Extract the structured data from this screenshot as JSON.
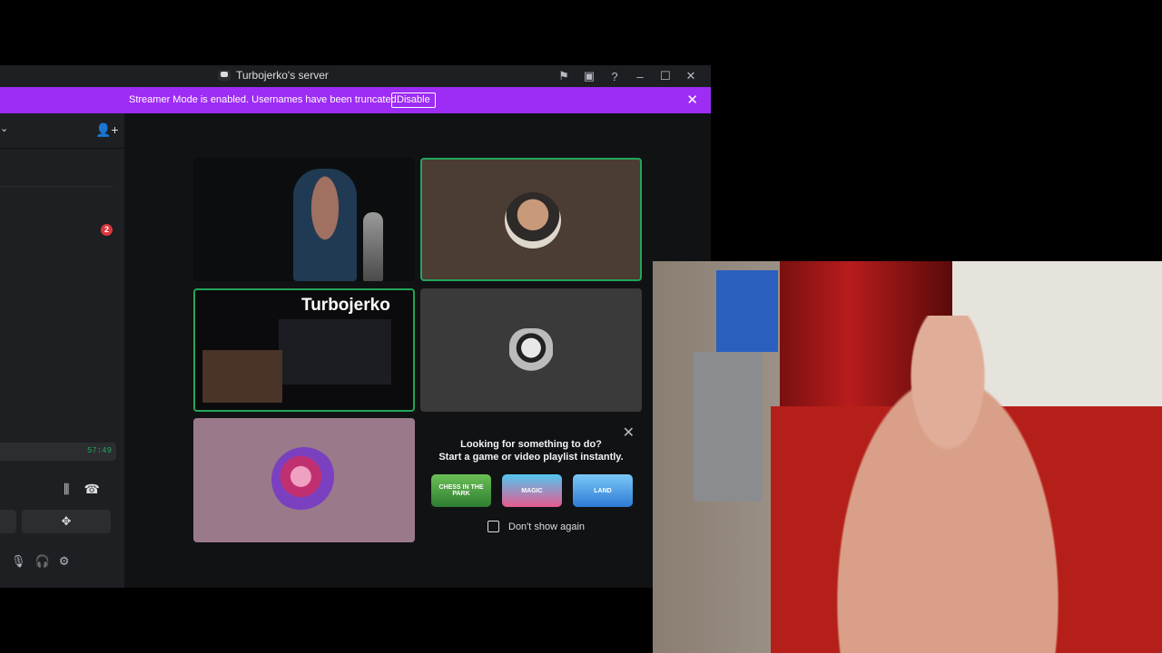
{
  "window": {
    "title": "Turbojerko's server",
    "controls": {
      "minimize": "–",
      "maximize": "☐",
      "close": "✕"
    }
  },
  "banner": {
    "text": "Streamer Mode is enabled. Usernames have been truncated.",
    "button": "Disable",
    "close": "✕"
  },
  "sidebar": {
    "badge": "2",
    "timer": "57:49"
  },
  "tiles": {
    "stream_title": "Turbojerko"
  },
  "activity": {
    "line1": "Looking for something to do?",
    "line2": "Start a game or video playlist instantly.",
    "games": [
      "CHESS IN THE PARK",
      "MAGIC",
      "LAND"
    ],
    "dont_show": "Don't show again",
    "close": "✕"
  },
  "colors": {
    "accent": "#9d2cf5",
    "speaking": "#23a559",
    "badge": "#da373c"
  }
}
